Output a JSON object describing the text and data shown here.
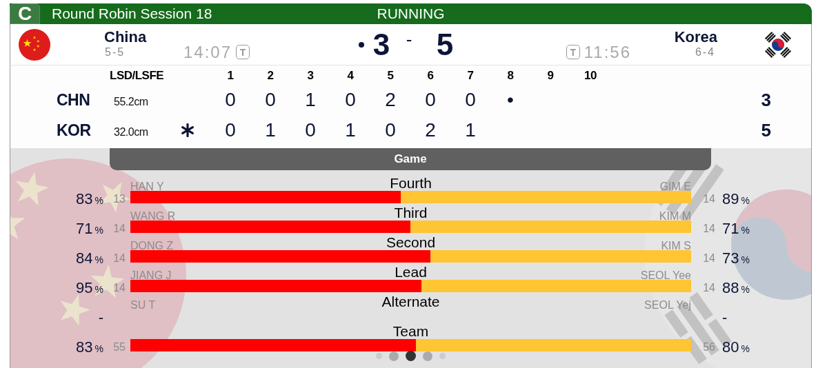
{
  "header": {
    "sheet": "C",
    "title": "Round Robin Session 18",
    "status": "RUNNING"
  },
  "teams": [
    {
      "kind": "china",
      "name": "China",
      "record": "5-5",
      "clock": "14:07",
      "clock_badge": "T",
      "score": "3",
      "throwing": true
    },
    {
      "kind": "korea",
      "name": "Korea",
      "record": "6-4",
      "clock": "11:56",
      "clock_badge": "T",
      "score": "5",
      "throwing": false
    }
  ],
  "score_separator": "-",
  "linescore": {
    "lsd_heading": "LSD/LSFE",
    "end_numbers": [
      "1",
      "2",
      "3",
      "4",
      "5",
      "6",
      "7",
      "8",
      "9",
      "10"
    ],
    "rows": [
      {
        "code": "CHN",
        "lsd": "55.2cm",
        "hammer": false,
        "ends": [
          "0",
          "0",
          "1",
          "0",
          "2",
          "0",
          "0",
          "•"
        ],
        "total": "3"
      },
      {
        "code": "KOR",
        "lsd": "32.0cm",
        "hammer": true,
        "ends": [
          "0",
          "1",
          "0",
          "1",
          "0",
          "2",
          "1"
        ],
        "total": "5"
      }
    ]
  },
  "stats": {
    "heading": "Game",
    "rows": [
      {
        "position": "Fourth",
        "left": {
          "name": "HAN Y",
          "shots": "13",
          "percent": "83",
          "unit": "%"
        },
        "right": {
          "name": "GIM E",
          "shots": "14",
          "percent": "89",
          "unit": "%"
        },
        "level": 0.482
      },
      {
        "position": "Third",
        "left": {
          "name": "WANG R",
          "shots": "14",
          "percent": "71",
          "unit": "%"
        },
        "right": {
          "name": "KIM M",
          "shots": "14",
          "percent": "71",
          "unit": "%"
        },
        "level": 0.499
      },
      {
        "position": "Second",
        "left": {
          "name": "DONG Z",
          "shots": "14",
          "percent": "84",
          "unit": "%"
        },
        "right": {
          "name": "KIM S",
          "shots": "14",
          "percent": "73",
          "unit": "%"
        },
        "level": 0.535
      },
      {
        "position": "Lead",
        "left": {
          "name": "JIANG J",
          "shots": "14",
          "percent": "95",
          "unit": "%"
        },
        "right": {
          "name": "SEOL Yee",
          "shots": "14",
          "percent": "88",
          "unit": "%"
        },
        "level": 0.519
      },
      {
        "position": "Alternate",
        "left": {
          "name": "SU T",
          "percent": "-"
        },
        "right": {
          "name": "SEOL Yej",
          "percent": "-"
        }
      },
      {
        "position": "Team",
        "left": {
          "shots": "55",
          "percent": "83",
          "unit": "%"
        },
        "right": {
          "shots": "56",
          "percent": "80",
          "unit": "%"
        },
        "level": 0.509
      }
    ]
  },
  "pager": [
    {
      "selected": false
    },
    {
      "selected": false
    },
    {
      "selected": true
    },
    {
      "selected": false
    },
    {
      "selected": false
    }
  ]
}
